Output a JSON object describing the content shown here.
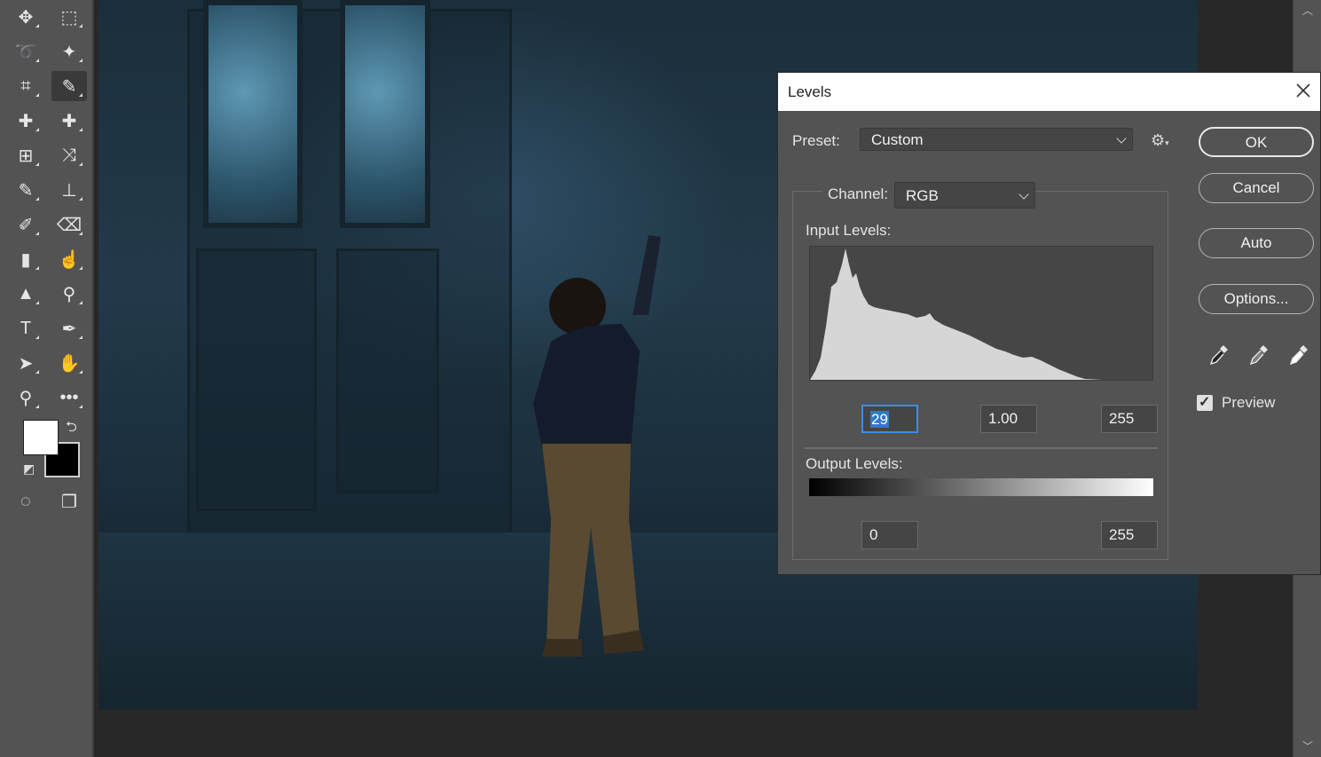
{
  "toolbar": {
    "tools": [
      {
        "name": "move-tool",
        "glyph": "✥",
        "active": false
      },
      {
        "name": "rectangular-marquee-tool",
        "glyph": "⬚",
        "active": false
      },
      {
        "name": "lasso-tool",
        "glyph": "➰",
        "active": false
      },
      {
        "name": "magic-wand-tool",
        "glyph": "✦",
        "active": false
      },
      {
        "name": "crop-tool",
        "glyph": "⌗",
        "active": false
      },
      {
        "name": "eyedropper-tool",
        "glyph": "✎",
        "active": true
      },
      {
        "name": "spot-healing-tool",
        "glyph": "✚",
        "active": false
      },
      {
        "name": "healing-brush-tool",
        "glyph": "✚",
        "active": false
      },
      {
        "name": "content-aware-tool",
        "glyph": "⊞",
        "active": false
      },
      {
        "name": "content-aware-move-tool",
        "glyph": "⤨",
        "active": false
      },
      {
        "name": "brush-tool",
        "glyph": "✎",
        "active": false
      },
      {
        "name": "clone-stamp-tool",
        "glyph": "⊥",
        "active": false
      },
      {
        "name": "history-brush-tool",
        "glyph": "✐",
        "active": false
      },
      {
        "name": "eraser-tool",
        "glyph": "⌫",
        "active": false
      },
      {
        "name": "gradient-tool",
        "glyph": "▮",
        "active": false
      },
      {
        "name": "smudge-tool",
        "glyph": "☝",
        "active": false
      },
      {
        "name": "sharpen-tool",
        "glyph": "▲",
        "active": false
      },
      {
        "name": "dodge-tool",
        "glyph": "⚲",
        "active": false
      },
      {
        "name": "type-tool",
        "glyph": "T",
        "active": false
      },
      {
        "name": "pen-tool",
        "glyph": "✒",
        "active": false
      },
      {
        "name": "path-selection-tool",
        "glyph": "➤",
        "active": false
      },
      {
        "name": "hand-tool",
        "glyph": "✋",
        "active": false
      },
      {
        "name": "zoom-tool",
        "glyph": "⚲",
        "active": false
      },
      {
        "name": "more-tools",
        "glyph": "•••",
        "active": false
      },
      {
        "name": "quick-mask-mode",
        "glyph": "◌",
        "active": false
      },
      {
        "name": "screen-mode",
        "glyph": "❐",
        "active": false
      }
    ],
    "swap_glyph": "⮌",
    "default_colors_glyph": "◩",
    "foreground_color": "#ffffff",
    "background_color": "#000000"
  },
  "dialog": {
    "title": "Levels",
    "preset_label": "Preset:",
    "preset_value": "Custom",
    "gear_glyph": "⚙",
    "channel_label": "Channel:",
    "channel_value": "RGB",
    "input_levels_label": "Input Levels:",
    "input_black": "29",
    "input_gamma": "1.00",
    "input_white": "255",
    "output_levels_label": "Output Levels:",
    "output_black": "0",
    "output_white": "255",
    "buttons": {
      "ok": "OK",
      "cancel": "Cancel",
      "auto": "Auto",
      "options": "Options..."
    },
    "preview_label": "Preview",
    "preview_checked": true,
    "check_glyph": "✓",
    "slider_positions": {
      "input_black": 29,
      "input_gamma": 1.0,
      "input_white": 255,
      "output_black": 0,
      "output_white": 255
    }
  },
  "colors": {
    "accent_focus": "#3b8de6",
    "panel_bg": "#535353"
  }
}
